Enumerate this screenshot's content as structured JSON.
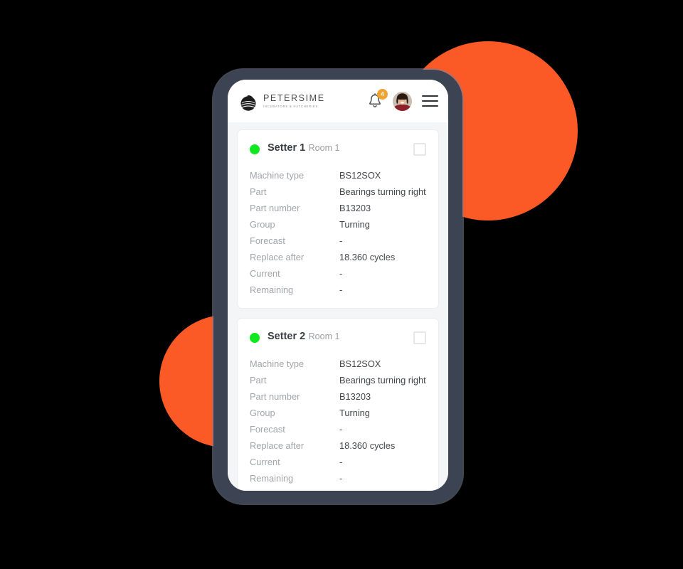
{
  "background": {
    "canvas_color": "#000000",
    "accent_color": "#fb5a26",
    "circles": [
      "top-right-orange-circle",
      "bottom-left-orange-circle"
    ]
  },
  "device": {
    "frame_color": "#3c4352",
    "screen_background": "#f4f5f6"
  },
  "header": {
    "brand_name": "PETERSIME",
    "brand_tagline": "INCUBATORS & HATCHERIES",
    "logo_icon": "petersime-egg-logo",
    "notifications": {
      "icon": "bell-icon",
      "badge_count": "4",
      "badge_color": "#f0a32e"
    },
    "avatar": {
      "icon": "user-avatar",
      "alt": "User profile photo"
    },
    "menu": {
      "icon": "hamburger-menu-icon"
    }
  },
  "spec_labels": {
    "machine_type": "Machine type",
    "part": "Part",
    "part_number": "Part number",
    "group": "Group",
    "forecast": "Forecast",
    "replace_after": "Replace after",
    "current": "Current",
    "remaining": "Remaining"
  },
  "cards": [
    {
      "title": "Setter 1",
      "subtitle": "Room 1",
      "status_color": "#0fe81f",
      "checked": false,
      "specs": {
        "machine_type": "BS12SOX",
        "part": "Bearings turning right",
        "part_number": "B13203",
        "group": "Turning",
        "forecast": "-",
        "replace_after": "18.360 cycles",
        "current": "-",
        "remaining": "-"
      }
    },
    {
      "title": "Setter 2",
      "subtitle": "Room 1",
      "status_color": "#0fe81f",
      "checked": false,
      "specs": {
        "machine_type": "BS12SOX",
        "part": "Bearings turning right",
        "part_number": "B13203",
        "group": "Turning",
        "forecast": "-",
        "replace_after": "18.360 cycles",
        "current": "-",
        "remaining": "-"
      }
    }
  ]
}
